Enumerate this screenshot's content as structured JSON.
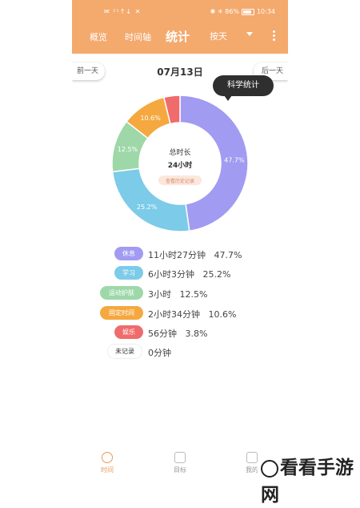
{
  "status": {
    "left": "✉ ²¹↑↓ ✕",
    "right": "✱ ✳ 86%",
    "time": "10:34"
  },
  "nav": {
    "tabs": [
      "概览",
      "时间轴",
      "统计"
    ],
    "dropdown": "按天"
  },
  "datebar": {
    "prev": "前一天",
    "date": "07月13日",
    "next": "后一天"
  },
  "tooltip": "科学统计",
  "donut": {
    "center_title": "总时长",
    "center_value": "24小时",
    "center_button": "查看历史记录"
  },
  "chart_data": {
    "type": "pie",
    "slices": [
      {
        "name": "休息",
        "value": 47.7,
        "label": "47.7%",
        "color": "#a29bf2"
      },
      {
        "name": "学习",
        "value": 25.2,
        "label": "25.2%",
        "color": "#7ccbe8"
      },
      {
        "name": "运动护肤",
        "value": 12.5,
        "label": "12.5%",
        "color": "#9ed8a9"
      },
      {
        "name": "固定时间",
        "value": 10.6,
        "label": "10.6%",
        "color": "#f5a83f"
      },
      {
        "name": "娱乐",
        "value": 3.8,
        "label": "",
        "color": "#f06b6b"
      }
    ]
  },
  "legend": [
    {
      "name": "休息",
      "duration": "11小时27分钟",
      "percent": "47.7%",
      "color": "#a29bf2"
    },
    {
      "name": "学习",
      "duration": "6小时3分钟",
      "percent": "25.2%",
      "color": "#7ccbe8"
    },
    {
      "name": "运动护肤",
      "duration": "3小时",
      "percent": "12.5%",
      "color": "#9ed8a9"
    },
    {
      "name": "固定时间",
      "duration": "2小时34分钟",
      "percent": "10.6%",
      "color": "#f5a83f"
    },
    {
      "name": "娱乐",
      "duration": "56分钟",
      "percent": "3.8%",
      "color": "#f06b6b"
    },
    {
      "name": "未记录",
      "duration": "0分钟",
      "percent": "",
      "color": "#ffffff"
    }
  ],
  "tabbar": [
    {
      "label": "时间",
      "icon": "clock-icon"
    },
    {
      "label": "目标",
      "icon": "calendar-icon"
    },
    {
      "label": "我的",
      "icon": "alarm-icon"
    }
  ],
  "watermark": "看看手游网"
}
